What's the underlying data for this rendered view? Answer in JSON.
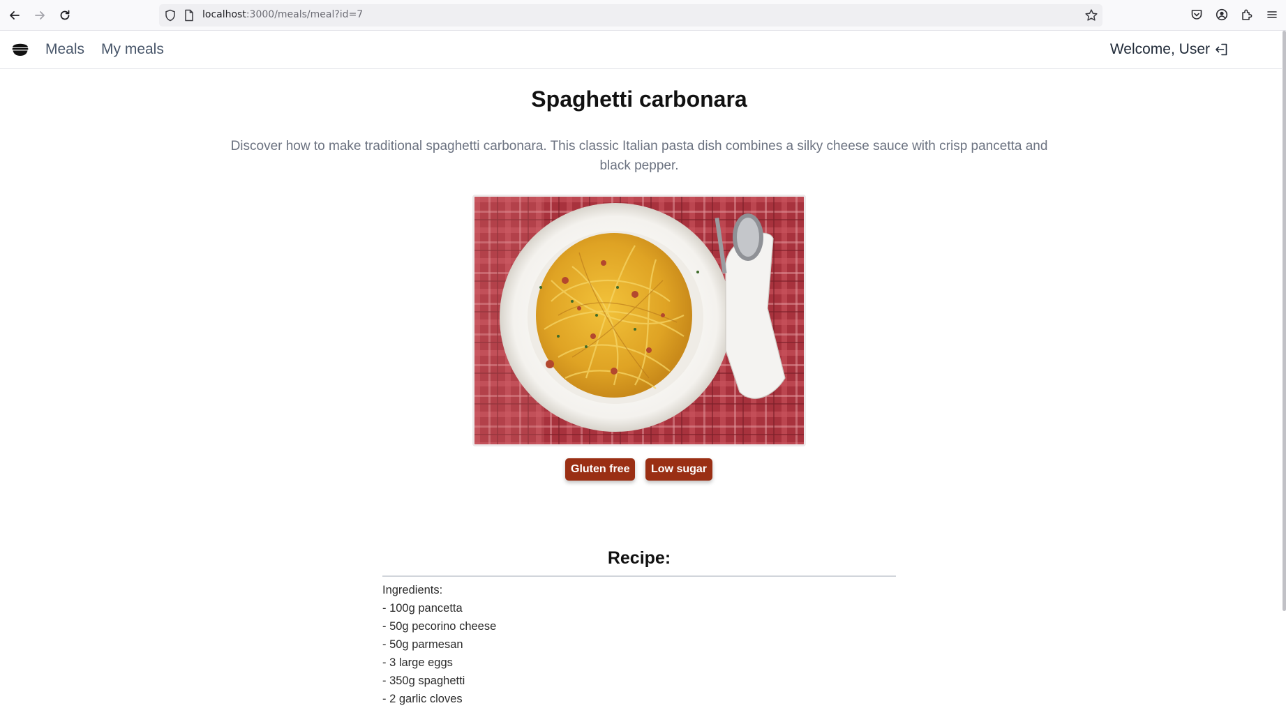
{
  "browser": {
    "url_host": "localhost",
    "url_rest": ":3000/meals/meal?id=7"
  },
  "header": {
    "logo_icon": "bowl-logo-icon",
    "nav": [
      {
        "label": "Meals"
      },
      {
        "label": "My meals"
      }
    ],
    "welcome": "Welcome, User",
    "logout_icon": "logout-icon"
  },
  "meal": {
    "title": "Spaghetti carbonara",
    "description": "Discover how to make traditional spaghetti carbonara. This classic Italian pasta dish combines a silky cheese sauce with crisp pancetta and black pepper.",
    "tags": [
      {
        "label": "Gluten free"
      },
      {
        "label": "Low sugar"
      }
    ],
    "tag_color": "#9a2f14"
  },
  "recipe": {
    "heading": "Recipe:",
    "lines": [
      "Ingredients:",
      "- 100g pancetta",
      "- 50g pecorino cheese",
      "- 50g parmesan",
      "- 3 large eggs",
      "- 350g spaghetti",
      "- 2 garlic cloves"
    ]
  }
}
